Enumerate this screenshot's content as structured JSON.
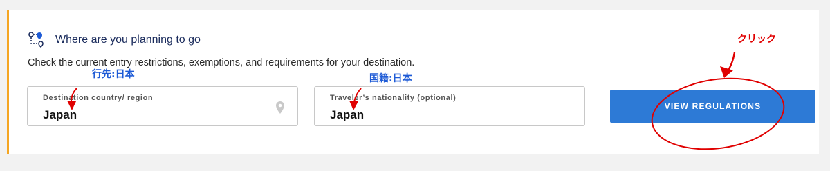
{
  "section": {
    "title": "Where are you planning to go",
    "description": "Check the current entry restrictions, exemptions, and requirements for your destination.",
    "icon": "route-icon",
    "accent_color": "#f5a623"
  },
  "destination": {
    "label": "Destination country/ region",
    "value": "Japan",
    "icon": "location-pin-icon"
  },
  "nationality": {
    "label": "Traveler’s nationality (optional)",
    "value": "Japan"
  },
  "button": {
    "label": "VIEW REGULATIONS",
    "color": "#2d7ad6"
  },
  "annotations": {
    "destination_note": "行先:日本",
    "nationality_note": "国籍:日本",
    "click_note": "クリック"
  }
}
